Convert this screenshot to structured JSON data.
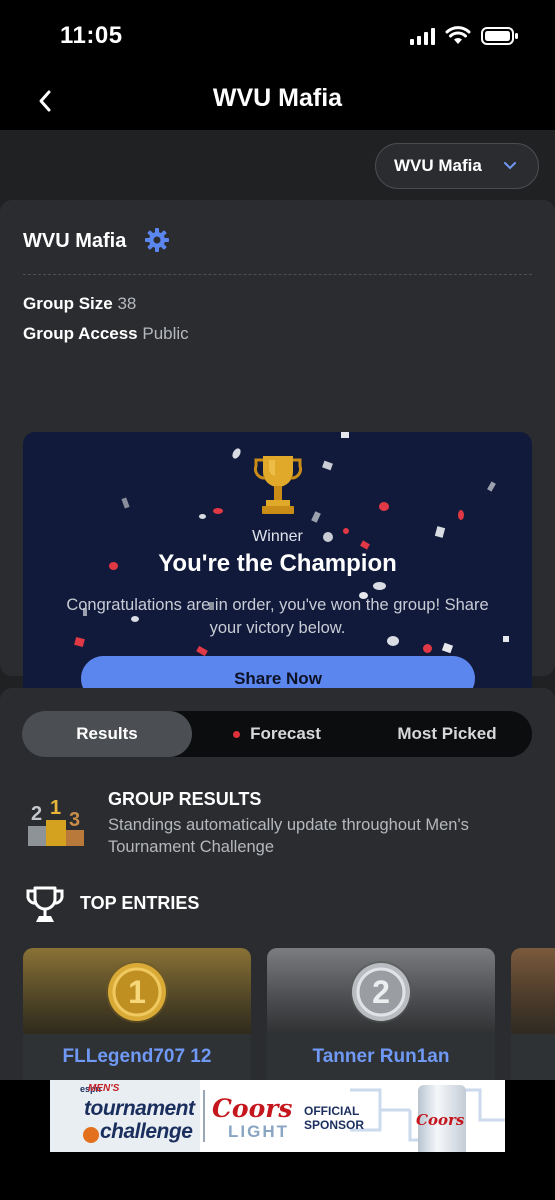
{
  "status_bar": {
    "time": "11:05"
  },
  "nav": {
    "title": "WVU Mafia"
  },
  "group_selector": {
    "value": "WVU Mafia"
  },
  "group_info": {
    "name": "WVU Mafia",
    "size_label": "Group Size",
    "size_value": "38",
    "access_label": "Group Access",
    "access_value": "Public"
  },
  "champion_card": {
    "winner_label": "Winner",
    "title": "You're the Champion",
    "subtitle": "Congratulations are in order, you've won the group! Share your victory below.",
    "button": "Share Now"
  },
  "tabs": [
    {
      "label": "Results",
      "active": true
    },
    {
      "label": "Forecast",
      "active": false,
      "live_dot": true
    },
    {
      "label": "Most Picked",
      "active": false
    }
  ],
  "group_results": {
    "title": "GROUP RESULTS",
    "description": "Standings automatically update throughout Men's Tournament Challenge"
  },
  "top_entries": {
    "title": "TOP ENTRIES",
    "entries": [
      {
        "rank": "1",
        "name": "FLLegend707 12"
      },
      {
        "rank": "2",
        "name": "Tanner Run1an"
      }
    ]
  },
  "ad": {
    "espn": "espn",
    "mens": "MEN'S",
    "line1": "tournament",
    "line2": "challenge",
    "brand": "Coors",
    "brand_sub": "LIGHT",
    "sponsor": "OFFICIAL SPONSOR",
    "can_text": "Coors"
  },
  "colors": {
    "accent_blue": "#5b86ee",
    "live_red": "#e0303a",
    "gold": "#d4a21e",
    "champion_bg": "#111a3a"
  }
}
